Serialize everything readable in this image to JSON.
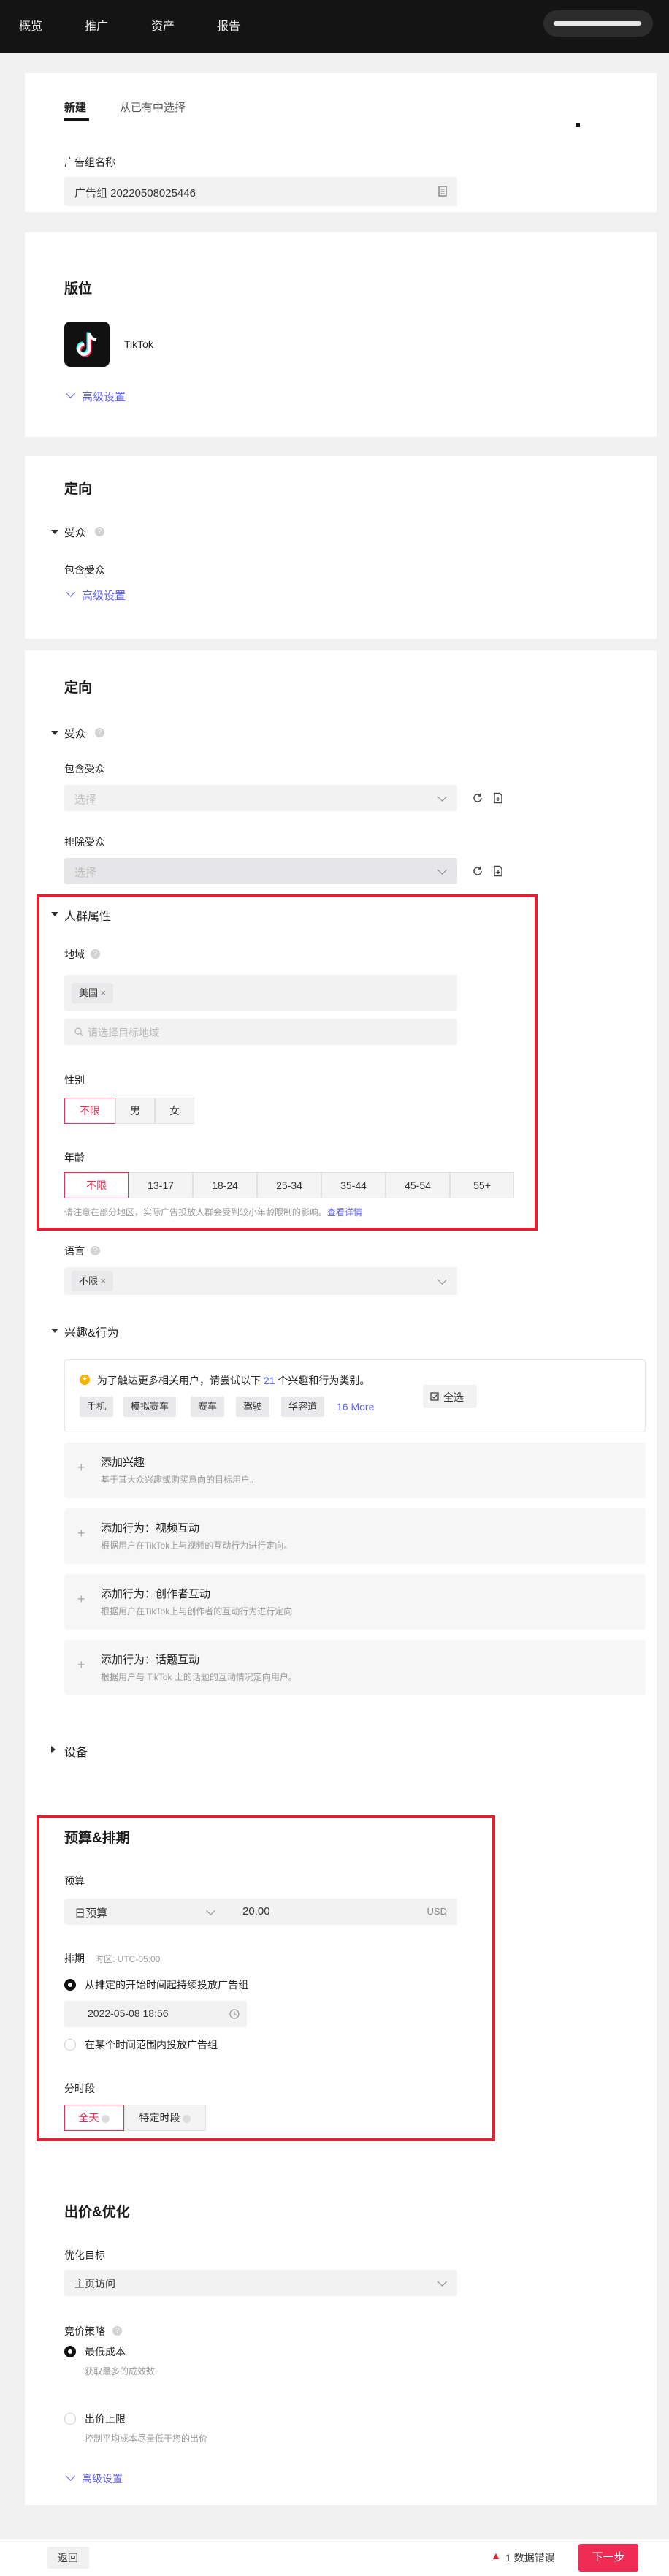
{
  "topnav": {
    "items": [
      "概览",
      "推广",
      "资产",
      "报告"
    ]
  },
  "tabs": {
    "new": "新建",
    "existing": "从已有中选择"
  },
  "adgroup": {
    "name_label": "广告组名称",
    "name_value": "广告组 20220508025446"
  },
  "placement": {
    "title": "版位",
    "app": "TikTok",
    "advanced": "高级设置"
  },
  "targeting1": {
    "title": "定向",
    "audience": "受众",
    "include": "包含受众",
    "advanced": "高级设置"
  },
  "targeting2": {
    "title": "定向",
    "audience": "受众",
    "include": "包含受众",
    "include_placeholder": "选择",
    "exclude": "排除受众",
    "exclude_placeholder": "选择"
  },
  "demographics": {
    "title": "人群属性",
    "location_label": "地域",
    "location_tag": "美国",
    "location_placeholder": "请选择目标地域",
    "gender_label": "性别",
    "gender_options": [
      "不限",
      "男",
      "女"
    ],
    "age_label": "年龄",
    "age_options": [
      "不限",
      "13-17",
      "18-24",
      "25-34",
      "35-44",
      "45-54",
      "55+"
    ],
    "age_note": "请注意在部分地区，实际广告投放人群会受到较小年龄限制的影响。",
    "age_note_link": "查看详情"
  },
  "language": {
    "label": "语言",
    "tag": "不限"
  },
  "interests": {
    "title": "兴趣&行为",
    "tip_pre": "为了触达更多相关用户，请尝试以下",
    "tip_num": "21",
    "tip_post": "个兴趣和行为类别。",
    "tags": [
      "手机",
      "模拟赛车",
      "赛车",
      "驾驶",
      "华容道"
    ],
    "more": "16 More",
    "select_all": "全选",
    "cards": [
      {
        "title": "添加兴趣",
        "desc": "基于其大众兴趣或购买意向的目标用户。"
      },
      {
        "title": "添加行为：视频互动",
        "desc": "根据用户在TikTok上与视频的互动行为进行定向。"
      },
      {
        "title": "添加行为：创作者互动",
        "desc": "根据用户在TikTok上与创作者的互动行为进行定向"
      },
      {
        "title": "添加行为：话题互动",
        "desc": "根据用户与 TikTok 上的话题的互动情况定向用户。"
      }
    ]
  },
  "device": {
    "title": "设备"
  },
  "budget": {
    "title": "预算&排期",
    "budget_label": "预算",
    "budget_type": "日预算",
    "budget_value": "20.00",
    "currency": "USD",
    "schedule_label": "排期",
    "timezone": "时区: UTC-05:00",
    "opt_continuous": "从排定的开始时间起持续投放广告组",
    "start_datetime": "2022-05-08 18:56",
    "opt_range": "在某个时间范围内投放广告组",
    "dayparting_label": "分时段",
    "dayparting_options": [
      "全天",
      "特定时段"
    ]
  },
  "bidding": {
    "title": "出价&优化",
    "goal_label": "优化目标",
    "goal_value": "主页访问",
    "strategy_label": "竞价策略",
    "lowest_cost": "最低成本",
    "lowest_cost_desc": "获取最多的成效数",
    "cost_cap": "出价上限",
    "cost_cap_desc": "控制平均成本尽量低于您的出价",
    "advanced": "高级设置"
  },
  "footer": {
    "back": "返回",
    "errors": "1 数据错误",
    "next": "下一步"
  },
  "colors": {
    "accent": "#f02c55",
    "link": "#5b5ff0",
    "highlight": "#e22031"
  }
}
